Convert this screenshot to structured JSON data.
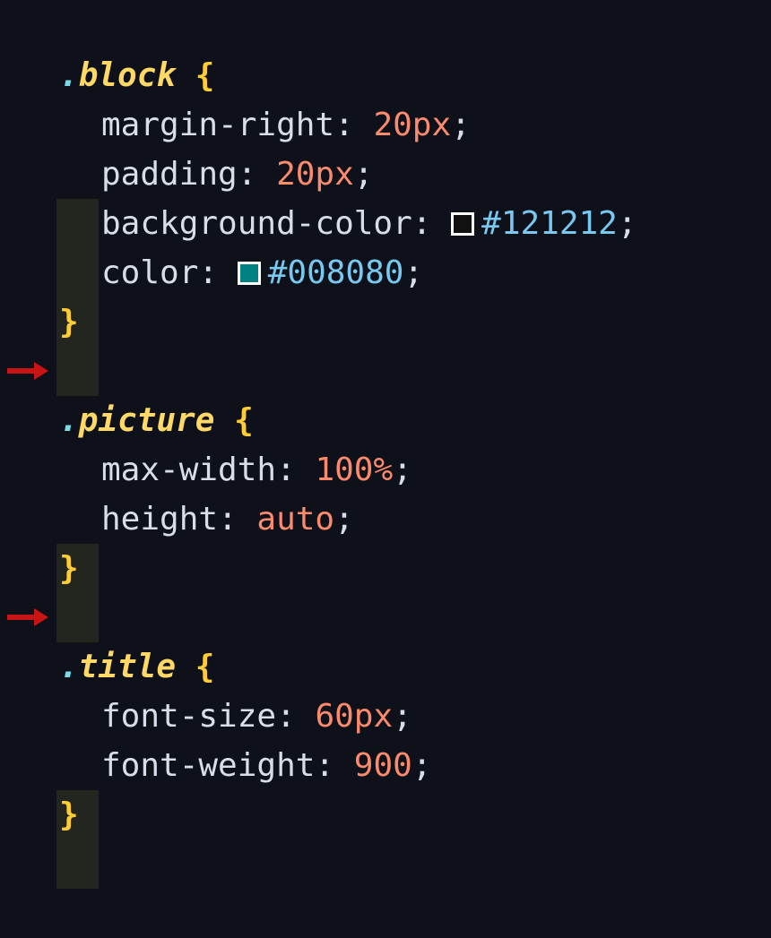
{
  "theme": {
    "background": "#0e111a",
    "selector_color": "#ffd866",
    "brace_color": "#ffcc33",
    "property_color": "#d8dee9",
    "value_color": "#fc8a6c",
    "hex_color": "#78c8f0",
    "indent_guide_color": "#23261f",
    "arrow_color": "#c81414"
  },
  "rules": [
    {
      "selector_dot": ".",
      "selector_name": "block",
      "open_brace": "{",
      "close_brace": "}",
      "declarations": [
        {
          "property": "margin-right",
          "colon": ": ",
          "value": "20px",
          "semicolon": ";"
        },
        {
          "property": "padding",
          "colon": ": ",
          "value": "20px",
          "semicolon": ";"
        },
        {
          "property": "background-color",
          "colon": ": ",
          "value": "#121212",
          "semicolon": ";",
          "swatch": "#121212"
        },
        {
          "property": "color",
          "colon": ": ",
          "value": "#008080",
          "semicolon": ";",
          "swatch": "#008080"
        }
      ]
    },
    {
      "selector_dot": ".",
      "selector_name": "picture",
      "open_brace": "{",
      "close_brace": "}",
      "declarations": [
        {
          "property": "max-width",
          "colon": ": ",
          "value": "100%",
          "semicolon": ";"
        },
        {
          "property": "height",
          "colon": ": ",
          "value": "auto",
          "semicolon": ";"
        }
      ]
    },
    {
      "selector_dot": ".",
      "selector_name": "title",
      "open_brace": "{",
      "close_brace": "}",
      "declarations": [
        {
          "property": "font-size",
          "colon": ": ",
          "value": "60px",
          "semicolon": ";"
        },
        {
          "property": "font-weight",
          "colon": ": ",
          "value": "900",
          "semicolon": ";"
        }
      ]
    }
  ],
  "markers": [
    {
      "icon": "red-arrow-icon"
    },
    {
      "icon": "red-arrow-icon"
    }
  ]
}
